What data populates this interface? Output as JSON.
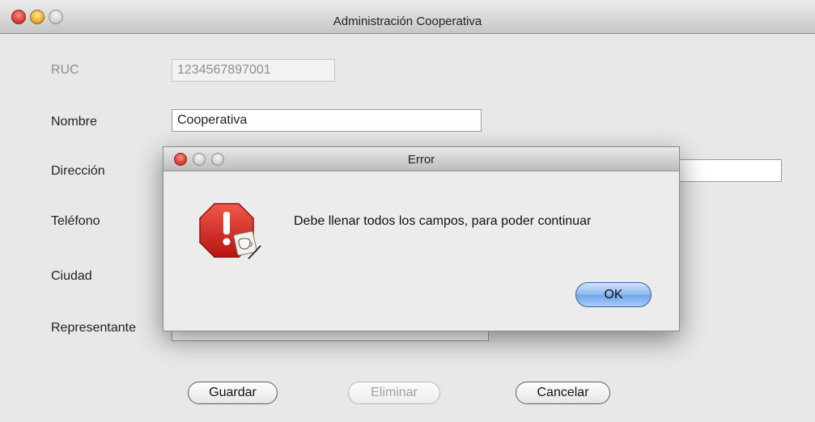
{
  "window": {
    "title": "Administración Cooperativa"
  },
  "form": {
    "ruc": {
      "label": "RUC",
      "value": "1234567897001"
    },
    "nombre": {
      "label": "Nombre",
      "value": "Cooperativa"
    },
    "direccion": {
      "label": "Dirección",
      "value": ""
    },
    "telefono": {
      "label": "Teléfono",
      "value": ""
    },
    "ciudad": {
      "label": "Ciudad",
      "value": ""
    },
    "representante": {
      "label": "Representante",
      "value": ""
    }
  },
  "buttons": {
    "guardar": "Guardar",
    "eliminar": "Eliminar",
    "cancelar": "Cancelar"
  },
  "dialog": {
    "title": "Error",
    "message": "Debe  llenar todos los campos, para poder continuar",
    "ok": "OK",
    "icon": "stop-warning-icon"
  },
  "colors": {
    "close": "#e0463d",
    "minimize": "#f0b43c",
    "ok_accent": "#6ea4e8",
    "stop_icon": "#d9261c"
  }
}
